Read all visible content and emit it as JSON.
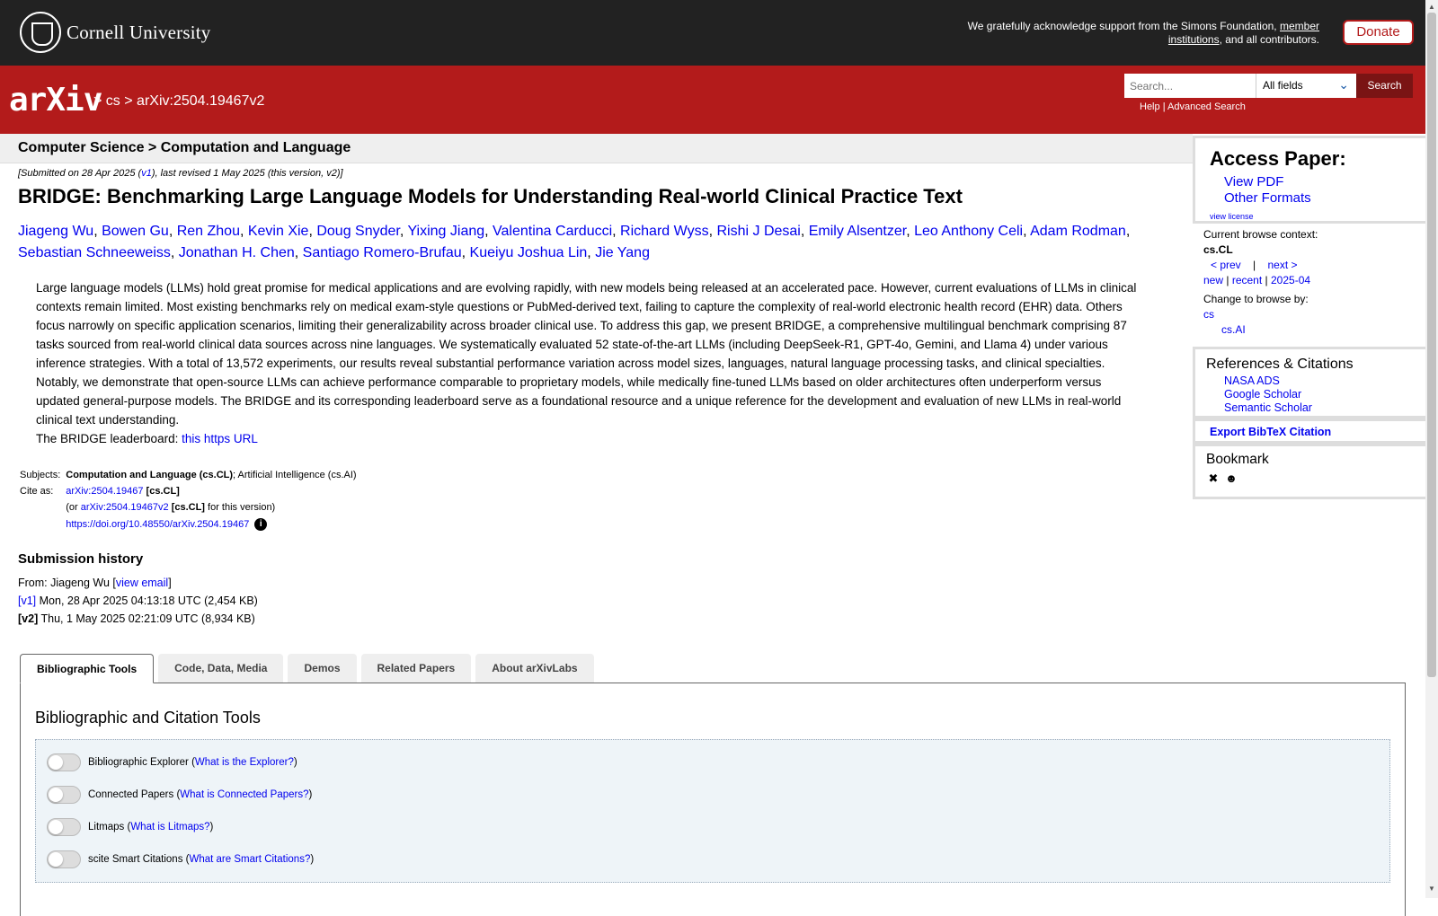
{
  "topbar": {
    "university": "Cornell University",
    "ack_prefix": "We gratefully acknowledge support from the Simons Foundation,",
    "ack_link": "member institutions",
    "ack_suffix": ", and all contributors.",
    "donate": "Donate"
  },
  "header": {
    "logo": "arXiv",
    "crumb_sep1": ">",
    "crumb_cs": "cs",
    "crumb_sep2": ">",
    "crumb_id": "arXiv:2504.19467v2",
    "search_placeholder": "Search...",
    "search_field": "All fields",
    "search_button": "Search",
    "help": "Help",
    "help_sep": "|",
    "advanced": "Advanced Search"
  },
  "paper": {
    "subject_header": "Computer Science > Computation and Language",
    "date_prefix": "[Submitted on 28 Apr 2025 (",
    "date_v1": "v1",
    "date_suffix": "), last revised 1 May 2025 (this version, v2)]",
    "title": "BRIDGE: Benchmarking Large Language Models for Understanding Real-world Clinical Practice Text",
    "authors": [
      "Jiageng Wu",
      "Bowen Gu",
      "Ren Zhou",
      "Kevin Xie",
      "Doug Snyder",
      "Yixing Jiang",
      "Valentina Carducci",
      "Richard Wyss",
      "Rishi J Desai",
      "Emily Alsentzer",
      "Leo Anthony Celi",
      "Adam Rodman",
      "Sebastian Schneeweiss",
      "Jonathan H. Chen",
      "Santiago Romero-Brufau",
      "Kueiyu Joshua Lin",
      "Jie Yang"
    ],
    "abstract": "Large language models (LLMs) hold great promise for medical applications and are evolving rapidly, with new models being released at an accelerated pace. However, current evaluations of LLMs in clinical contexts remain limited. Most existing benchmarks rely on medical exam-style questions or PubMed-derived text, failing to capture the complexity of real-world electronic health record (EHR) data. Others focus narrowly on specific application scenarios, limiting their generalizability across broader clinical use. To address this gap, we present BRIDGE, a comprehensive multilingual benchmark comprising 87 tasks sourced from real-world clinical data sources across nine languages. We systematically evaluated 52 state-of-the-art LLMs (including DeepSeek-R1, GPT-4o, Gemini, and Llama 4) under various inference strategies. With a total of 13,572 experiments, our results reveal substantial performance variation across model sizes, languages, natural language processing tasks, and clinical specialties. Notably, we demonstrate that open-source LLMs can achieve performance comparable to proprietary models, while medically fine-tuned LLMs based on older architectures often underperform versus updated general-purpose models. The BRIDGE and its corresponding leaderboard serve as a foundational resource and a unique reference for the development and evaluation of new LLMs in real-world clinical text understanding.",
    "leaderboard_prefix": "The BRIDGE leaderboard:",
    "leaderboard_link": "this https URL",
    "subjects_label": "Subjects:",
    "subjects_primary": "Computation and Language (cs.CL)",
    "subjects_rest": "; Artificial Intelligence (cs.AI)",
    "cite_label": "Cite as:",
    "cite_id": "arXiv:2504.19467",
    "cite_cat": "[cs.CL]",
    "cite_or": "(or",
    "cite_v2": "arXiv:2504.19467v2",
    "cite_v2_cat": "[cs.CL]",
    "cite_v2_suffix": "for this version)",
    "doi": "https://doi.org/10.48550/arXiv.2504.19467"
  },
  "history": {
    "title": "Submission history",
    "from_prefix": "From: Jiageng Wu [",
    "view_email": "view email",
    "from_suffix": "]",
    "v1_label": "[v1]",
    "v1_text": "Mon, 28 Apr 2025 04:13:18 UTC (2,454 KB)",
    "v2_label": "[v2]",
    "v2_text": "Thu, 1 May 2025 02:21:09 UTC (8,934 KB)"
  },
  "tabs": [
    "Bibliographic Tools",
    "Code, Data, Media",
    "Demos",
    "Related Papers",
    "About arXivLabs"
  ],
  "panel": {
    "title": "Bibliographic and Citation Tools",
    "tools": [
      {
        "name": "Bibliographic Explorer",
        "link": "What is the Explorer?"
      },
      {
        "name": "Connected Papers",
        "link": "What is Connected Papers?"
      },
      {
        "name": "Litmaps",
        "link": "What is Litmaps?"
      },
      {
        "name": "scite Smart Citations",
        "link": "What are Smart Citations?"
      }
    ]
  },
  "sidebar": {
    "access_title": "Access Paper:",
    "view_pdf": "View PDF",
    "other_formats": "Other Formats",
    "view_license": "view license",
    "context_label": "Current browse context:",
    "context": "cs.CL",
    "prev": "< prev",
    "sep": "|",
    "next": "next >",
    "new": "new",
    "recent": "recent",
    "month": "2025-04",
    "change_label": "Change to browse by:",
    "browse_cs": "cs",
    "browse_ai": "cs.AI",
    "refs_title": "References & Citations",
    "nasa": "NASA ADS",
    "scholar": "Google Scholar",
    "semantic": "Semantic Scholar",
    "export": "Export BibTeX Citation",
    "bookmark_title": "Bookmark"
  }
}
